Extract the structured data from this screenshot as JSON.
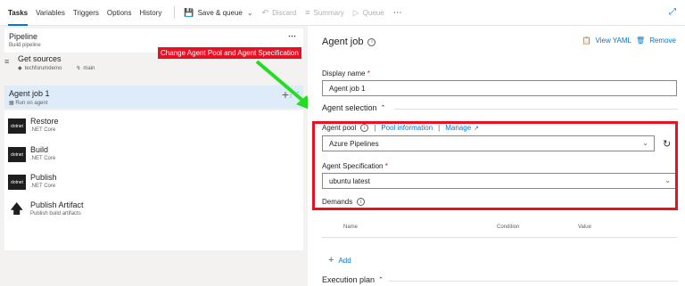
{
  "toolbar": {
    "tabs": [
      "Tasks",
      "Variables",
      "Triggers",
      "Options",
      "History"
    ],
    "save_queue": "Save & queue",
    "discard": "Discard",
    "summary": "Summary",
    "queue": "Queue"
  },
  "pipeline": {
    "title": "Pipeline",
    "subtitle": "Build pipeline"
  },
  "sources": {
    "title": "Get sources",
    "repo": "techforumdemo",
    "branch": "main"
  },
  "agent_job": {
    "title": "Agent job 1",
    "subtitle": "Run on agent"
  },
  "tasks": [
    {
      "name": "Restore",
      "desc": ".NET Core",
      "logo": "dotnet"
    },
    {
      "name": "Build",
      "desc": ".NET Core",
      "logo": "dotnet"
    },
    {
      "name": "Publish",
      "desc": ".NET Core",
      "logo": "dotnet"
    },
    {
      "name": "Publish Artifact",
      "desc": "Publish build artifacts",
      "logo": "upload-icon"
    }
  ],
  "annotation": "Change Agent Pool and Agent Specification",
  "right_panel": {
    "title": "Agent job",
    "view_yaml": "View YAML",
    "remove": "Remove",
    "display_name_label": "Display name",
    "display_name_value": "Agent job 1",
    "agent_selection": "Agent selection",
    "agent_pool_label": "Agent pool",
    "pool_information": "Pool information",
    "manage": "Manage",
    "agent_pool_value": "Azure Pipelines",
    "agent_spec_label": "Agent Specification",
    "agent_spec_value": "ubuntu latest",
    "demands": "Demands",
    "columns": [
      "Name",
      "Condition",
      "Value"
    ],
    "add": "Add",
    "execution_plan": "Execution plan"
  },
  "colors": {
    "accent": "#0078d4",
    "highlight": "#e81123",
    "arrow": "#22dd22"
  }
}
